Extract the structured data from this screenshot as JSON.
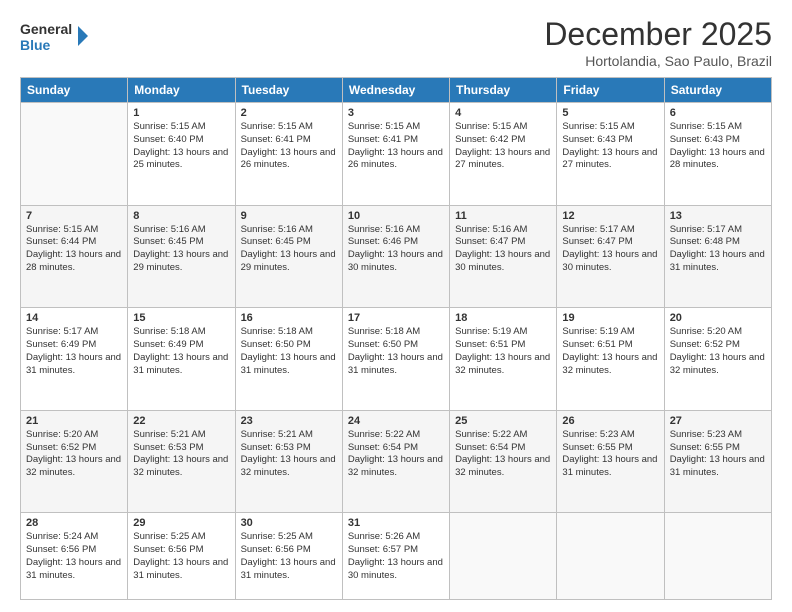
{
  "logo": {
    "line1": "General",
    "line2": "Blue"
  },
  "header": {
    "month": "December 2025",
    "location": "Hortolandia, Sao Paulo, Brazil"
  },
  "weekdays": [
    "Sunday",
    "Monday",
    "Tuesday",
    "Wednesday",
    "Thursday",
    "Friday",
    "Saturday"
  ],
  "weeks": [
    [
      {
        "day": "",
        "sunrise": "",
        "sunset": "",
        "daylight": ""
      },
      {
        "day": "1",
        "sunrise": "Sunrise: 5:15 AM",
        "sunset": "Sunset: 6:40 PM",
        "daylight": "Daylight: 13 hours and 25 minutes."
      },
      {
        "day": "2",
        "sunrise": "Sunrise: 5:15 AM",
        "sunset": "Sunset: 6:41 PM",
        "daylight": "Daylight: 13 hours and 26 minutes."
      },
      {
        "day": "3",
        "sunrise": "Sunrise: 5:15 AM",
        "sunset": "Sunset: 6:41 PM",
        "daylight": "Daylight: 13 hours and 26 minutes."
      },
      {
        "day": "4",
        "sunrise": "Sunrise: 5:15 AM",
        "sunset": "Sunset: 6:42 PM",
        "daylight": "Daylight: 13 hours and 27 minutes."
      },
      {
        "day": "5",
        "sunrise": "Sunrise: 5:15 AM",
        "sunset": "Sunset: 6:43 PM",
        "daylight": "Daylight: 13 hours and 27 minutes."
      },
      {
        "day": "6",
        "sunrise": "Sunrise: 5:15 AM",
        "sunset": "Sunset: 6:43 PM",
        "daylight": "Daylight: 13 hours and 28 minutes."
      }
    ],
    [
      {
        "day": "7",
        "sunrise": "Sunrise: 5:15 AM",
        "sunset": "Sunset: 6:44 PM",
        "daylight": "Daylight: 13 hours and 28 minutes."
      },
      {
        "day": "8",
        "sunrise": "Sunrise: 5:16 AM",
        "sunset": "Sunset: 6:45 PM",
        "daylight": "Daylight: 13 hours and 29 minutes."
      },
      {
        "day": "9",
        "sunrise": "Sunrise: 5:16 AM",
        "sunset": "Sunset: 6:45 PM",
        "daylight": "Daylight: 13 hours and 29 minutes."
      },
      {
        "day": "10",
        "sunrise": "Sunrise: 5:16 AM",
        "sunset": "Sunset: 6:46 PM",
        "daylight": "Daylight: 13 hours and 30 minutes."
      },
      {
        "day": "11",
        "sunrise": "Sunrise: 5:16 AM",
        "sunset": "Sunset: 6:47 PM",
        "daylight": "Daylight: 13 hours and 30 minutes."
      },
      {
        "day": "12",
        "sunrise": "Sunrise: 5:17 AM",
        "sunset": "Sunset: 6:47 PM",
        "daylight": "Daylight: 13 hours and 30 minutes."
      },
      {
        "day": "13",
        "sunrise": "Sunrise: 5:17 AM",
        "sunset": "Sunset: 6:48 PM",
        "daylight": "Daylight: 13 hours and 31 minutes."
      }
    ],
    [
      {
        "day": "14",
        "sunrise": "Sunrise: 5:17 AM",
        "sunset": "Sunset: 6:49 PM",
        "daylight": "Daylight: 13 hours and 31 minutes."
      },
      {
        "day": "15",
        "sunrise": "Sunrise: 5:18 AM",
        "sunset": "Sunset: 6:49 PM",
        "daylight": "Daylight: 13 hours and 31 minutes."
      },
      {
        "day": "16",
        "sunrise": "Sunrise: 5:18 AM",
        "sunset": "Sunset: 6:50 PM",
        "daylight": "Daylight: 13 hours and 31 minutes."
      },
      {
        "day": "17",
        "sunrise": "Sunrise: 5:18 AM",
        "sunset": "Sunset: 6:50 PM",
        "daylight": "Daylight: 13 hours and 31 minutes."
      },
      {
        "day": "18",
        "sunrise": "Sunrise: 5:19 AM",
        "sunset": "Sunset: 6:51 PM",
        "daylight": "Daylight: 13 hours and 32 minutes."
      },
      {
        "day": "19",
        "sunrise": "Sunrise: 5:19 AM",
        "sunset": "Sunset: 6:51 PM",
        "daylight": "Daylight: 13 hours and 32 minutes."
      },
      {
        "day": "20",
        "sunrise": "Sunrise: 5:20 AM",
        "sunset": "Sunset: 6:52 PM",
        "daylight": "Daylight: 13 hours and 32 minutes."
      }
    ],
    [
      {
        "day": "21",
        "sunrise": "Sunrise: 5:20 AM",
        "sunset": "Sunset: 6:52 PM",
        "daylight": "Daylight: 13 hours and 32 minutes."
      },
      {
        "day": "22",
        "sunrise": "Sunrise: 5:21 AM",
        "sunset": "Sunset: 6:53 PM",
        "daylight": "Daylight: 13 hours and 32 minutes."
      },
      {
        "day": "23",
        "sunrise": "Sunrise: 5:21 AM",
        "sunset": "Sunset: 6:53 PM",
        "daylight": "Daylight: 13 hours and 32 minutes."
      },
      {
        "day": "24",
        "sunrise": "Sunrise: 5:22 AM",
        "sunset": "Sunset: 6:54 PM",
        "daylight": "Daylight: 13 hours and 32 minutes."
      },
      {
        "day": "25",
        "sunrise": "Sunrise: 5:22 AM",
        "sunset": "Sunset: 6:54 PM",
        "daylight": "Daylight: 13 hours and 32 minutes."
      },
      {
        "day": "26",
        "sunrise": "Sunrise: 5:23 AM",
        "sunset": "Sunset: 6:55 PM",
        "daylight": "Daylight: 13 hours and 31 minutes."
      },
      {
        "day": "27",
        "sunrise": "Sunrise: 5:23 AM",
        "sunset": "Sunset: 6:55 PM",
        "daylight": "Daylight: 13 hours and 31 minutes."
      }
    ],
    [
      {
        "day": "28",
        "sunrise": "Sunrise: 5:24 AM",
        "sunset": "Sunset: 6:56 PM",
        "daylight": "Daylight: 13 hours and 31 minutes."
      },
      {
        "day": "29",
        "sunrise": "Sunrise: 5:25 AM",
        "sunset": "Sunset: 6:56 PM",
        "daylight": "Daylight: 13 hours and 31 minutes."
      },
      {
        "day": "30",
        "sunrise": "Sunrise: 5:25 AM",
        "sunset": "Sunset: 6:56 PM",
        "daylight": "Daylight: 13 hours and 31 minutes."
      },
      {
        "day": "31",
        "sunrise": "Sunrise: 5:26 AM",
        "sunset": "Sunset: 6:57 PM",
        "daylight": "Daylight: 13 hours and 30 minutes."
      },
      {
        "day": "",
        "sunrise": "",
        "sunset": "",
        "daylight": ""
      },
      {
        "day": "",
        "sunrise": "",
        "sunset": "",
        "daylight": ""
      },
      {
        "day": "",
        "sunrise": "",
        "sunset": "",
        "daylight": ""
      }
    ]
  ]
}
